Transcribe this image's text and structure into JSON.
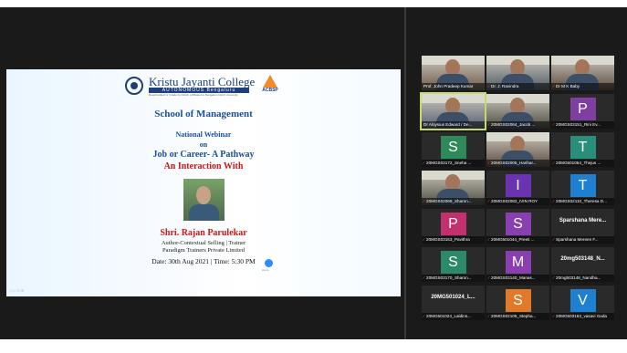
{
  "slide": {
    "college_name": "Kristu Jayanti College",
    "college_subtitle": "AUTONOMOUS  Bengaluru",
    "college_tagline": "Reaccredited 'A' Grade by NAAC | Affiliated to Bengaluru North University",
    "accreditation_badge": "ACBSP",
    "school": "School of Management",
    "event_type": "National Webinar",
    "on": "on",
    "topic_line1": "Job or Career- A Pathway",
    "topic_line2": "An Interaction With",
    "speaker_name": "Shri. Rajan Parulekar",
    "speaker_role1": "Author-Contextual Selling | Trainer",
    "speaker_role2": "Paradigm Trainers Private Limited",
    "date_time": "Date: 30th Aug 2021 | Time: 5:30 PM",
    "zoom_label": "zoom",
    "slide_controls": "◁ ▷ ⊡ ⊞"
  },
  "participants": [
    {
      "type": "video",
      "label": "Prof. John Pradeep Kumar",
      "muted": false
    },
    {
      "type": "video",
      "label": "Dr. J. Ravindra",
      "muted": true
    },
    {
      "type": "video",
      "label": "Dr M K Baby",
      "muted": true
    },
    {
      "type": "video",
      "label": "Dr Aloysius Edward / De...",
      "muted": false,
      "active": true
    },
    {
      "type": "video",
      "label": "20MGS02064_Jacob ...",
      "muted": true
    },
    {
      "type": "avatar",
      "letter": "P",
      "color": "#7e3fa0",
      "label": "20MGS03151_Rini Ev...",
      "muted": true
    },
    {
      "type": "avatar",
      "letter": "S",
      "color": "#2f8a5a",
      "label": "20MGS03172_Sneha ...",
      "muted": true
    },
    {
      "type": "video",
      "label": "20MGS02005_Harihar...",
      "muted": true
    },
    {
      "type": "avatar",
      "letter": "T",
      "color": "#2a8f7a",
      "label": "20MG501054_Thejus ...",
      "muted": true
    },
    {
      "type": "video",
      "label": "20MGS02069_Sharon...",
      "muted": true
    },
    {
      "type": "avatar",
      "letter": "I",
      "color": "#6a34b0",
      "label": "20MGS02082_IVIN ROY",
      "muted": true
    },
    {
      "type": "avatar",
      "letter": "T",
      "color": "#1f7fd0",
      "label": "20MGS02110_Theresa D...",
      "muted": true
    },
    {
      "type": "avatar",
      "letter": "P",
      "color": "#c2306e",
      "label": "20MGS03153_Pavithra",
      "muted": true
    },
    {
      "type": "avatar",
      "letter": "S",
      "color": "#8a3fb0",
      "label": "20MG501044_Preeti ...",
      "muted": true
    },
    {
      "type": "name",
      "bigname": "Sparshana  Mere...",
      "label": "Sparshana Mereen F...",
      "muted": true
    },
    {
      "type": "avatar",
      "letter": "S",
      "color": "#2b8a6a",
      "label": "20MGS03170_Sharon...",
      "muted": true
    },
    {
      "type": "avatar",
      "letter": "M",
      "color": "#8a3fb0",
      "label": "20MGS03140_Manas...",
      "muted": true
    },
    {
      "type": "name",
      "bigname": "20mg503148_N...",
      "label": "20mg503148_Nandha...",
      "muted": true
    },
    {
      "type": "name",
      "bigname": "20MG501024_L...",
      "label": "20MG501024_Laldins...",
      "muted": true
    },
    {
      "type": "avatar",
      "letter": "S",
      "color": "#e07a2a",
      "label": "20MGS02105_Stepha...",
      "muted": true
    },
    {
      "type": "avatar",
      "letter": "V",
      "color": "#1f7fd0",
      "label": "20MG503163_vasavi Gada",
      "muted": true
    }
  ],
  "colors": {
    "meeting_bg": "#1a1a1a",
    "tile_bg": "#2a2a2a",
    "active_speaker_border": "#c8d96a",
    "muted_icon": "#ff3b3b"
  }
}
